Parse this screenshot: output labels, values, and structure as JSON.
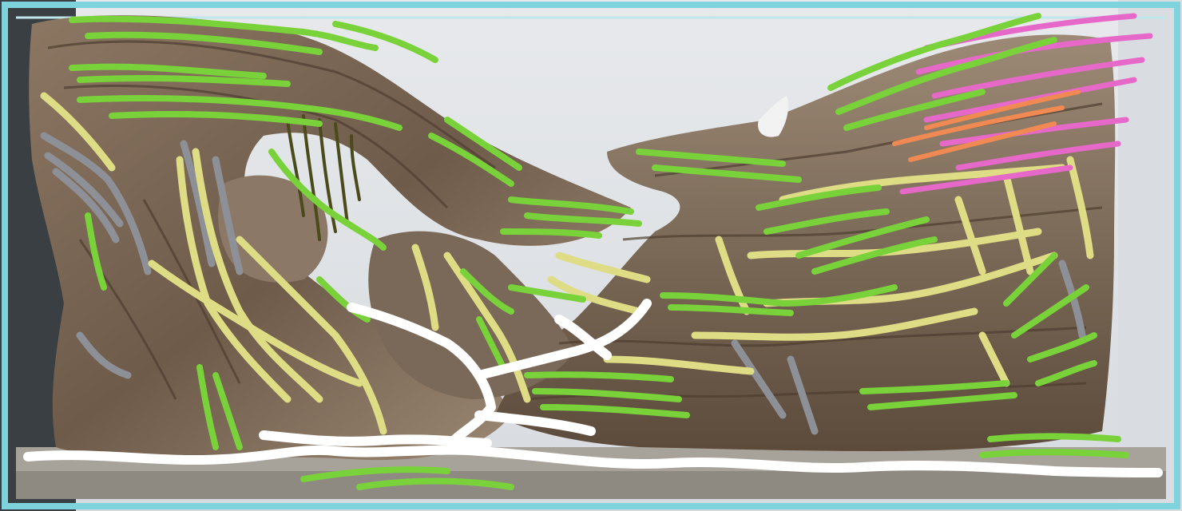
{
  "scene": {
    "subject": "aquascape-planting-sketch",
    "colors": {
      "wall": "#dfe2e6",
      "glass_edge": "#7fd3dc",
      "wood_dark": "#5b4a3c",
      "wood_mid": "#8a7562",
      "wood_light": "#b8a690",
      "substrate": "#a8a39a",
      "marker_green": "#79d23a",
      "marker_yellow": "#dedc84",
      "marker_grey": "#8d9096",
      "marker_white": "#ffffff",
      "marker_pink": "#e668c8",
      "marker_orange": "#f08a52",
      "marker_moss": "#4b4a1a"
    }
  }
}
